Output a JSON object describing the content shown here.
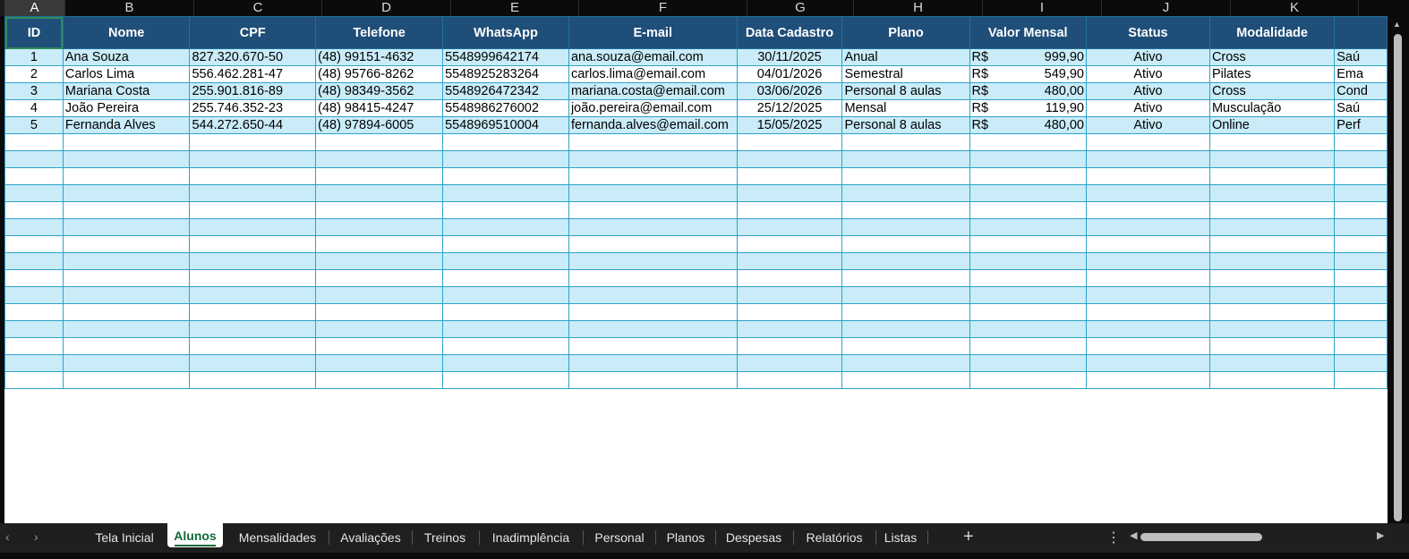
{
  "columns": [
    "A",
    "B",
    "C",
    "D",
    "E",
    "F",
    "G",
    "H",
    "I",
    "J",
    "K"
  ],
  "headers": [
    "ID",
    "Nome",
    "CPF",
    "Telefone",
    "WhatsApp",
    "E-mail",
    "Data Cadastro",
    "Plano",
    "Valor Mensal",
    "Status",
    "Modalidade"
  ],
  "rows": [
    {
      "id": "1",
      "nome": "Ana Souza",
      "cpf": "827.320.670-50",
      "telefone": "(48) 99151-4632",
      "whatsapp": "5548999642174",
      "email": "ana.souza@email.com",
      "data": "30/11/2025",
      "plano": "Anual",
      "moeda": "R$",
      "valor": "999,90",
      "status": "Ativo",
      "modalidade": "Cross",
      "extra": "Saú"
    },
    {
      "id": "2",
      "nome": "Carlos Lima",
      "cpf": "556.462.281-47",
      "telefone": "(48) 95766-8262",
      "whatsapp": "5548925283264",
      "email": "carlos.lima@email.com",
      "data": "04/01/2026",
      "plano": "Semestral",
      "moeda": "R$",
      "valor": "549,90",
      "status": "Ativo",
      "modalidade": "Pilates",
      "extra": "Ema"
    },
    {
      "id": "3",
      "nome": "Mariana Costa",
      "cpf": "255.901.816-89",
      "telefone": "(48) 98349-3562",
      "whatsapp": "5548926472342",
      "email": "mariana.costa@email.com",
      "data": "03/06/2026",
      "plano": "Personal 8 aulas",
      "moeda": "R$",
      "valor": "480,00",
      "status": "Ativo",
      "modalidade": "Cross",
      "extra": "Cond"
    },
    {
      "id": "4",
      "nome": "João Pereira",
      "cpf": "255.746.352-23",
      "telefone": "(48) 98415-4247",
      "whatsapp": "5548986276002",
      "email": "joão.pereira@email.com",
      "data": "25/12/2025",
      "plano": "Mensal",
      "moeda": "R$",
      "valor": "119,90",
      "status": "Ativo",
      "modalidade": "Musculação",
      "extra": "Saú"
    },
    {
      "id": "5",
      "nome": "Fernanda Alves",
      "cpf": "544.272.650-44",
      "telefone": "(48) 97894-6005",
      "whatsapp": "5548969510004",
      "email": "fernanda.alves@email.com",
      "data": "15/05/2025",
      "plano": "Personal 8 aulas",
      "moeda": "R$",
      "valor": "480,00",
      "status": "Ativo",
      "modalidade": "Online",
      "extra": "Perf"
    }
  ],
  "tabs": [
    "Tela Inicial",
    "Alunos",
    "Mensalidades",
    "Avaliações",
    "Treinos",
    "Inadimplência",
    "Personal",
    "Planos",
    "Despesas",
    "Relatórios",
    "Listas"
  ],
  "active_tab": "Alunos",
  "selected_cell": "A1",
  "icons": {
    "prev": "chevron-left-icon",
    "next": "chevron-right-icon",
    "add": "plus-icon",
    "more": "vertical-dots-icon"
  },
  "colors": {
    "header_bg": "#1f4e79",
    "band": "#c9ecf8",
    "grid_line": "#2ea3c9",
    "active_tab_text": "#0f6b3a"
  }
}
